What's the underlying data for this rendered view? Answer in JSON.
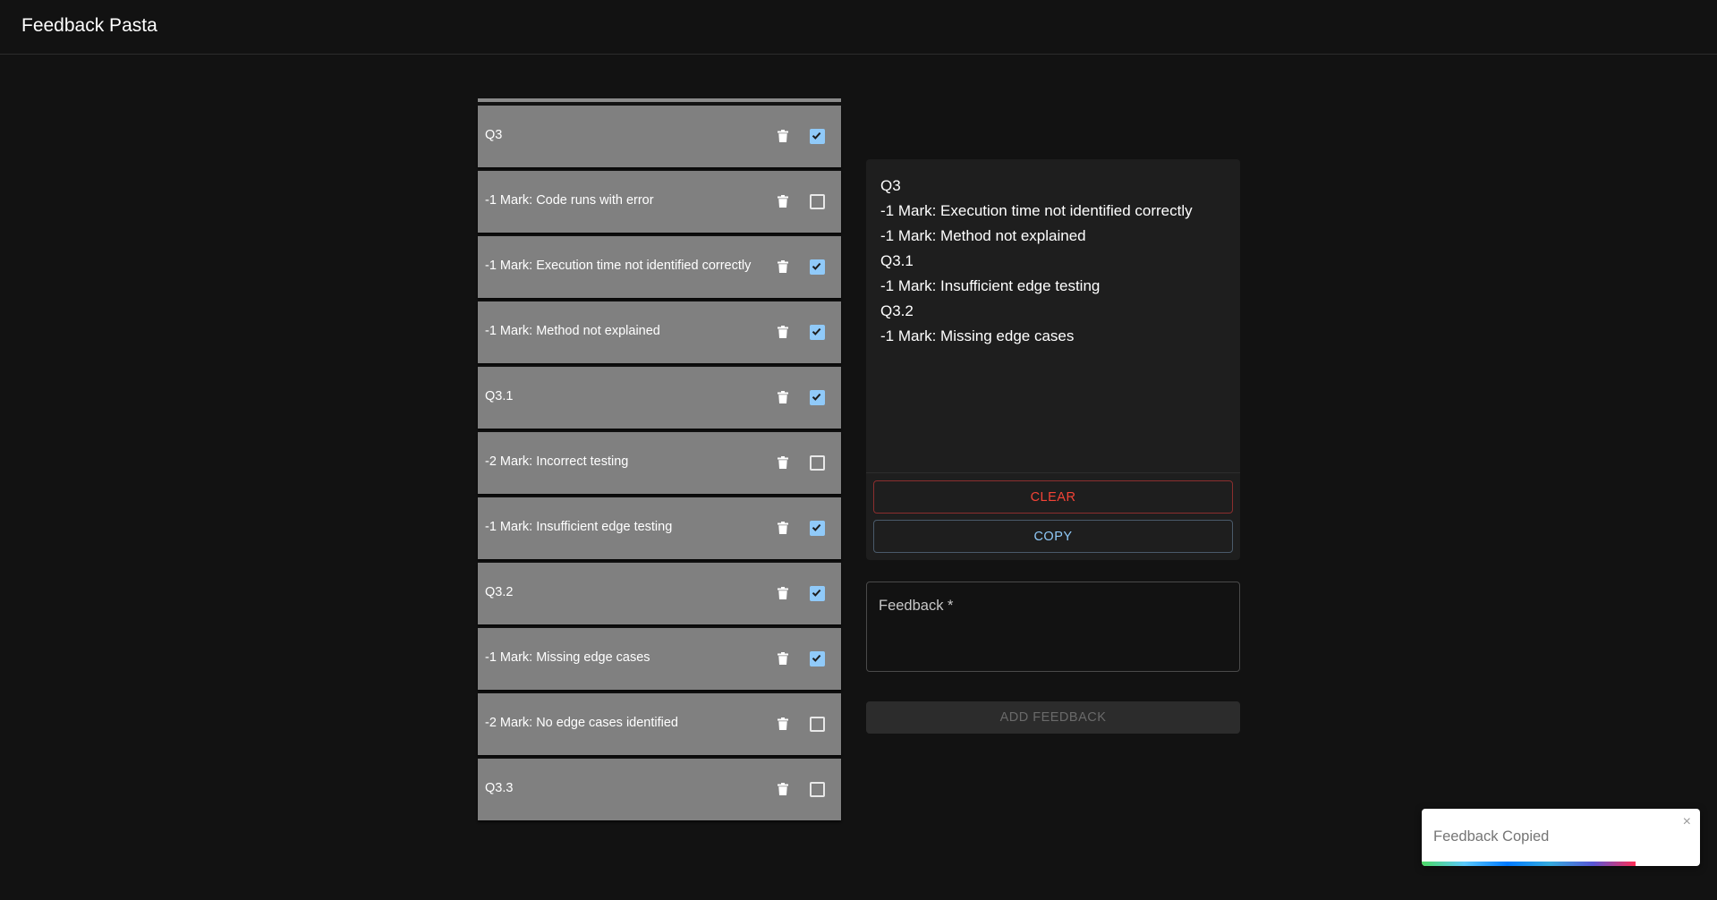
{
  "app": {
    "title": "Feedback Pasta"
  },
  "feedback_list": [
    {
      "label": "Q3",
      "checked": true
    },
    {
      "label": "-1 Mark: Code runs with error",
      "checked": false
    },
    {
      "label": "-1 Mark: Execution time not identified correctly",
      "checked": true
    },
    {
      "label": "-1 Mark: Method not explained",
      "checked": true
    },
    {
      "label": "Q3.1",
      "checked": true
    },
    {
      "label": "-2 Mark: Incorrect testing",
      "checked": false
    },
    {
      "label": "-1 Mark: Insufficient edge testing",
      "checked": true
    },
    {
      "label": "Q3.2",
      "checked": true
    },
    {
      "label": "-1 Mark: Missing edge cases",
      "checked": true
    },
    {
      "label": "-2 Mark: No edge cases identified",
      "checked": false
    },
    {
      "label": "Q3.3",
      "checked": false
    }
  ],
  "output": {
    "lines": [
      "Q3",
      "-1 Mark: Execution time not identified correctly",
      "-1 Mark: Method not explained",
      "Q3.1",
      "-1 Mark: Insufficient edge testing",
      "Q3.2",
      "-1 Mark: Missing edge cases"
    ],
    "clear_label": "CLEAR",
    "copy_label": "COPY"
  },
  "feedback_input": {
    "label": "Feedback *",
    "value": ""
  },
  "add_button_label": "ADD FEEDBACK",
  "toast": {
    "message": "Feedback Copied",
    "close_symbol": "×",
    "progress": 0.77
  },
  "icons": {
    "delete": "trash-icon",
    "check": "check-icon",
    "close": "close-icon"
  },
  "colors": {
    "background": "#121212",
    "item_background": "#808080",
    "panel_background": "#1e1e1e",
    "checkbox_checked": "#90caf9",
    "clear_color": "#f44336",
    "copy_color": "#90caf9"
  }
}
